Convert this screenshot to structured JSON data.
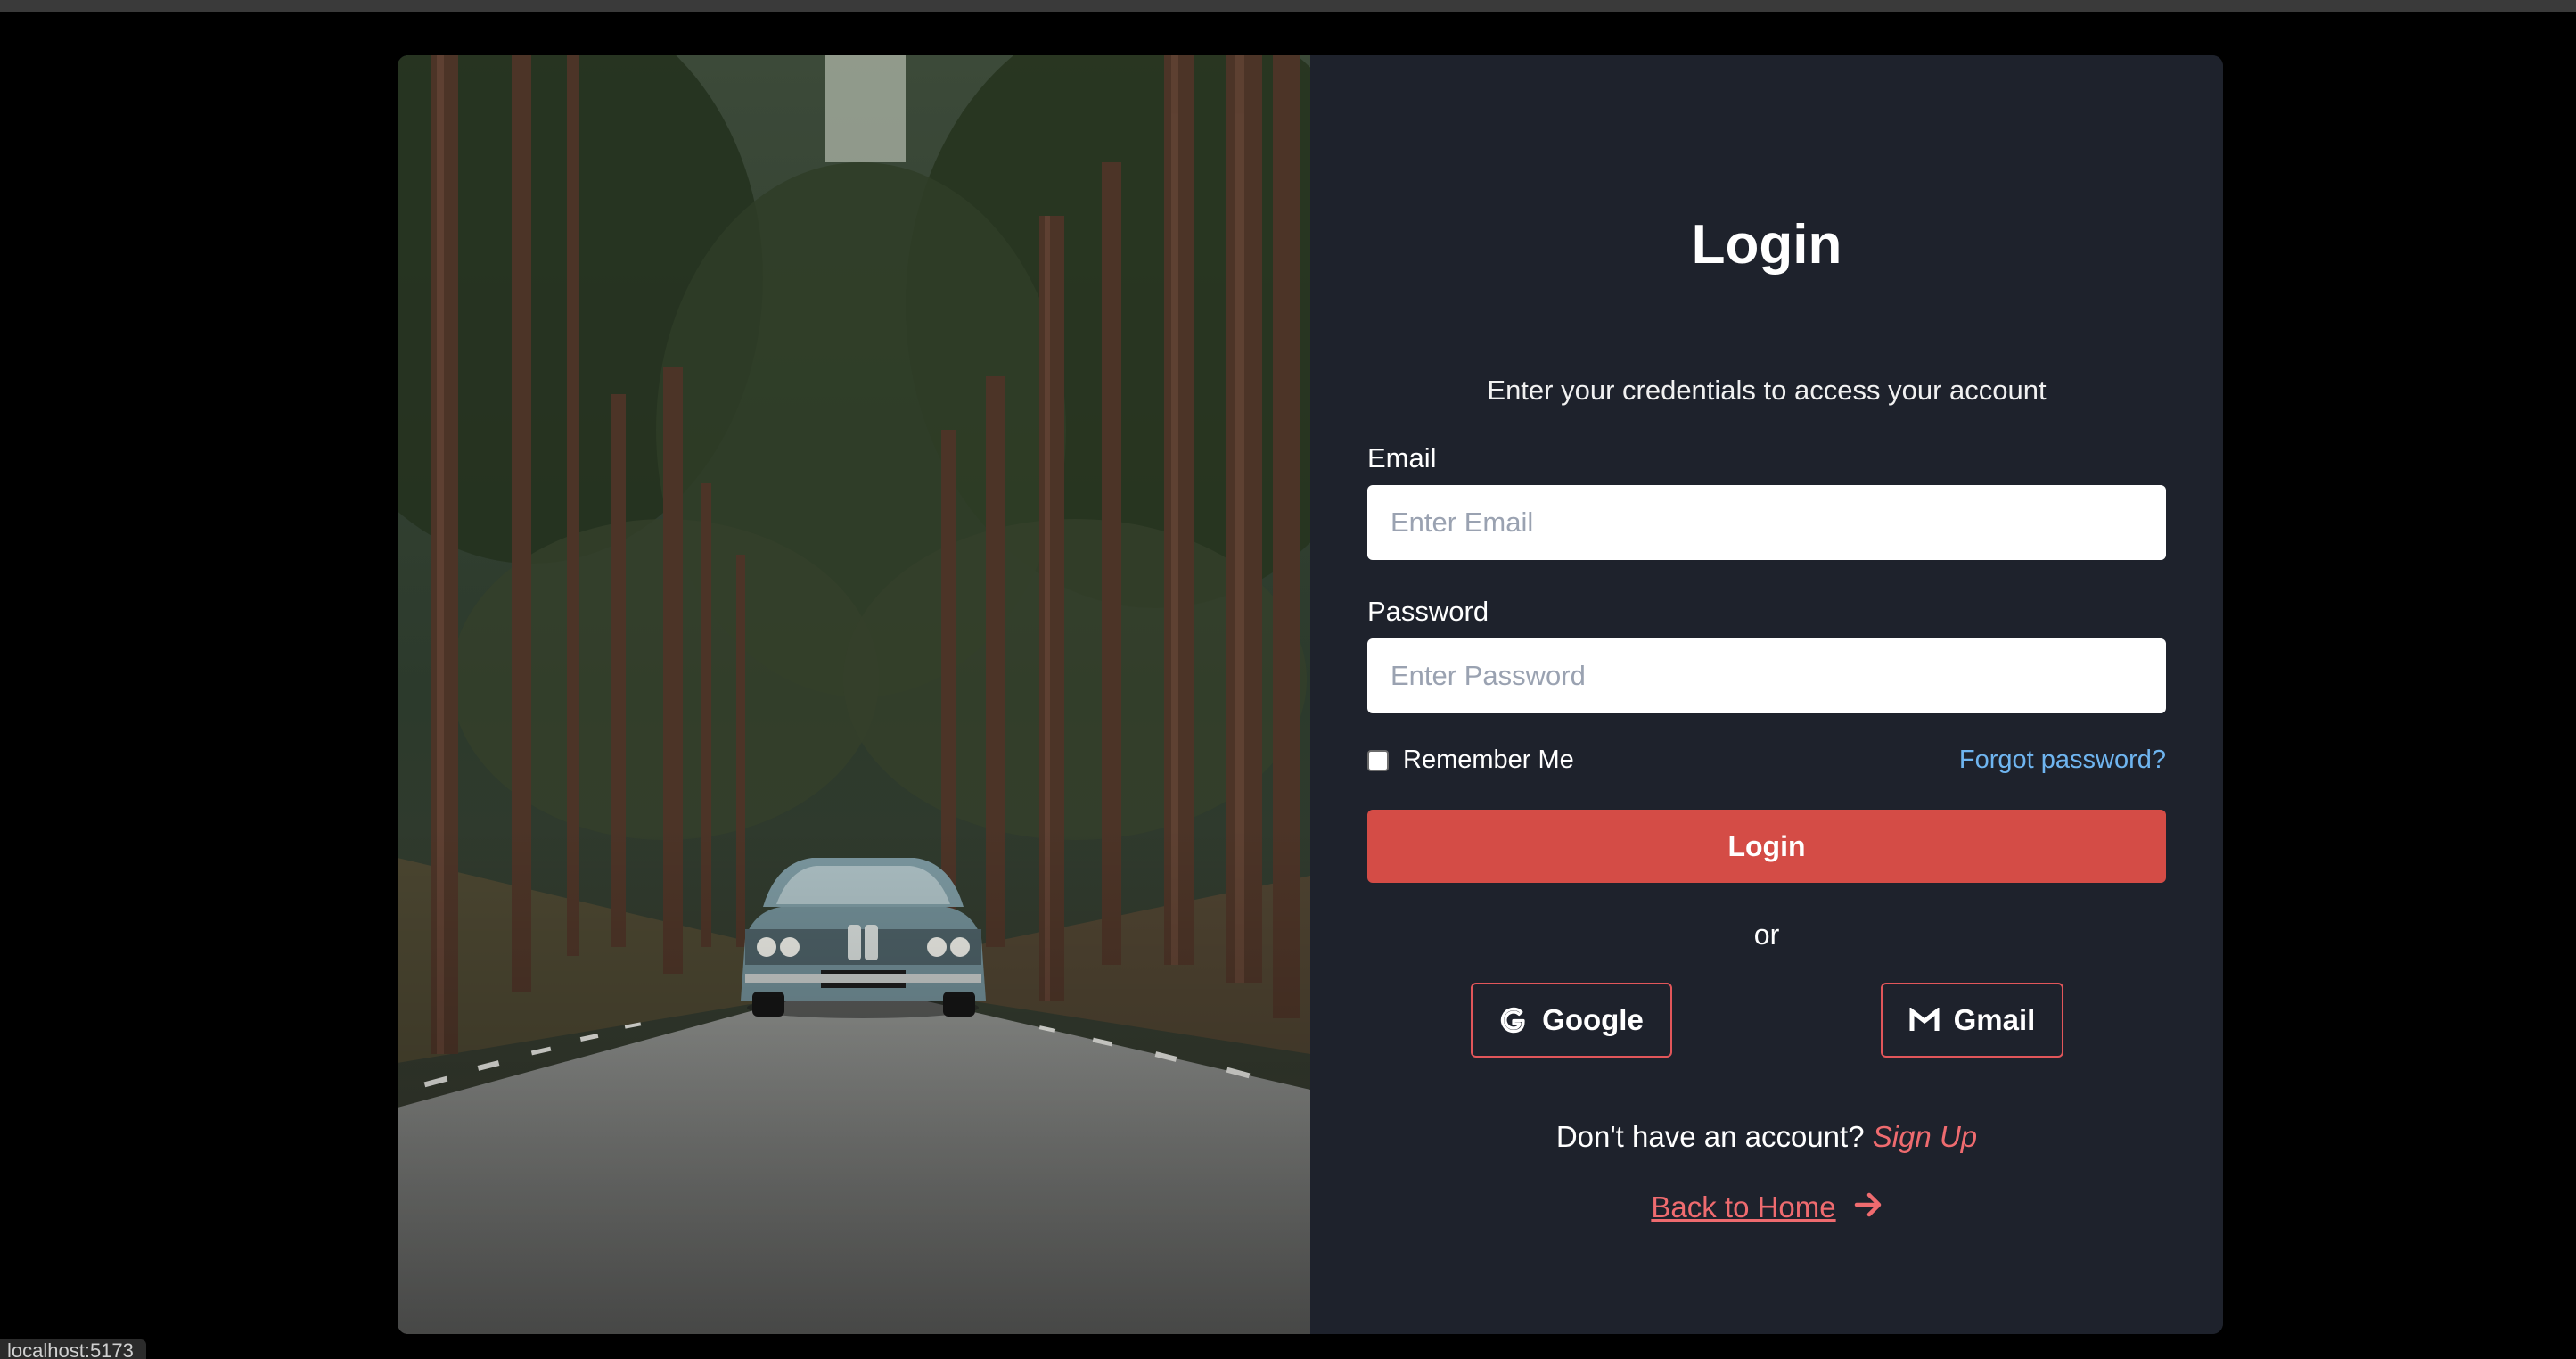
{
  "login": {
    "title": "Login",
    "subtitle": "Enter your credentials to access your account",
    "email": {
      "label": "Email",
      "placeholder": "Enter Email",
      "value": ""
    },
    "password": {
      "label": "Password",
      "placeholder": "Enter Password",
      "value": ""
    },
    "remember_me": {
      "label": "Remember Me",
      "checked": false
    },
    "forgot_password": "Forgot password?",
    "submit_label": "Login",
    "divider": "or",
    "social": {
      "google": {
        "label": "Google",
        "icon": "google-g-icon"
      },
      "gmail": {
        "label": "Gmail",
        "icon": "gmail-m-icon"
      }
    },
    "signup": {
      "prompt": "Don't have an account?",
      "link": "Sign Up"
    },
    "back_home": {
      "label": "Back to Home",
      "icon": "arrow-right-icon"
    }
  },
  "status_bar": {
    "url": "localhost:5173"
  },
  "colors": {
    "page_background": "#000000",
    "panel_background": "#1e222c",
    "primary": "#d44c46",
    "accent_link": "#ef6b6f",
    "forgot_link": "#6fb5f0"
  }
}
